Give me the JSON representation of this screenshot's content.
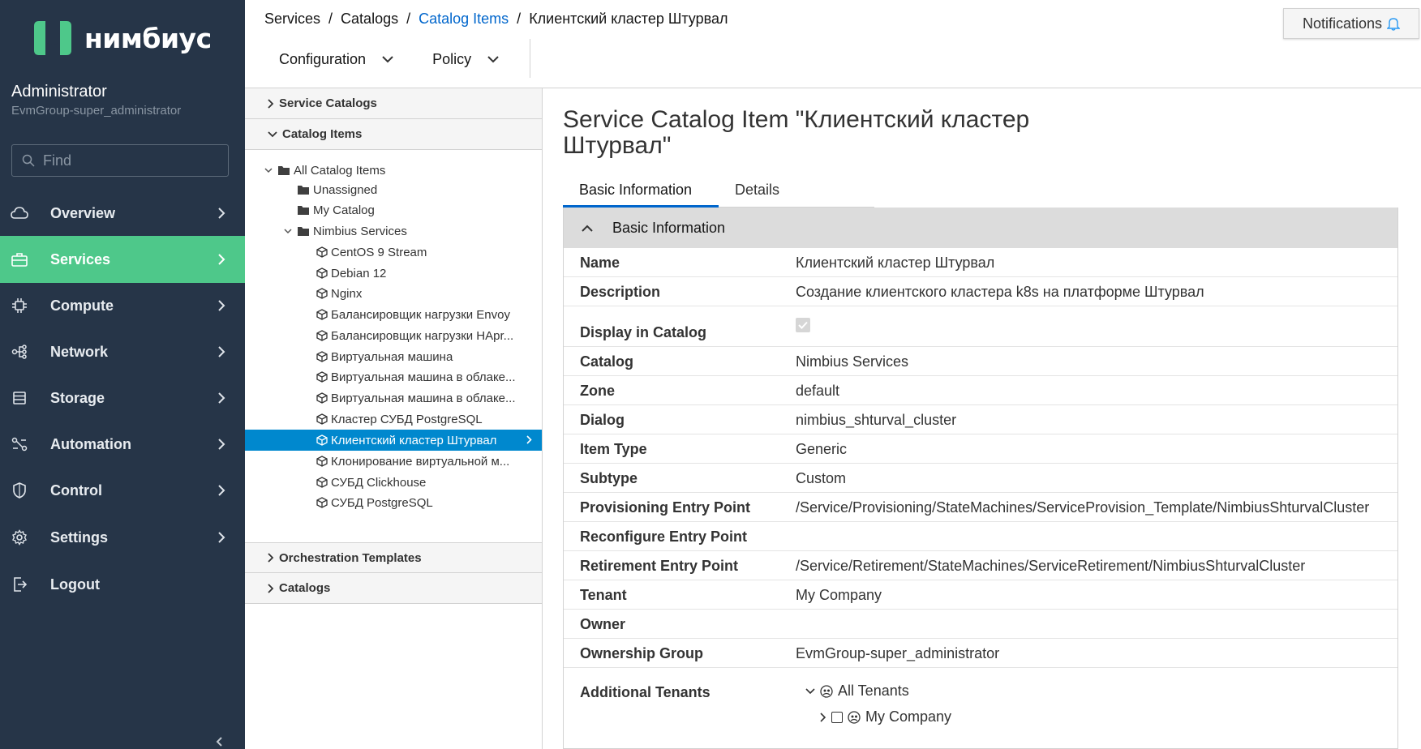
{
  "brand": {
    "name": "нимбиус",
    "color": "#4ec88a"
  },
  "user": {
    "name": "Administrator",
    "group": "EvmGroup-super_administrator"
  },
  "search": {
    "placeholder": "Find"
  },
  "nav": [
    {
      "label": "Overview",
      "icon": "cloud-icon",
      "active": false
    },
    {
      "label": "Services",
      "icon": "briefcase-icon",
      "active": true
    },
    {
      "label": "Compute",
      "icon": "chip-icon",
      "active": false
    },
    {
      "label": "Network",
      "icon": "network-icon",
      "active": false
    },
    {
      "label": "Storage",
      "icon": "storage-icon",
      "active": false
    },
    {
      "label": "Automation",
      "icon": "automation-icon",
      "active": false
    },
    {
      "label": "Control",
      "icon": "shield-icon",
      "active": false
    },
    {
      "label": "Settings",
      "icon": "gear-icon",
      "active": false
    },
    {
      "label": "Logout",
      "icon": "logout-icon",
      "active": false
    }
  ],
  "breadcrumb": [
    "Services",
    "Catalogs",
    "Catalog Items",
    "Клиентский кластер Штурвал"
  ],
  "toolbar": {
    "configuration": "Configuration",
    "policy": "Policy"
  },
  "notifications": "Notifications",
  "accordion": {
    "service_catalogs": "Service Catalogs",
    "catalog_items": "Catalog Items",
    "orchestration_templates": "Orchestration Templates",
    "catalogs": "Catalogs"
  },
  "tree": [
    {
      "label": "All Catalog Items",
      "type": "folder",
      "level": 0,
      "expanded": true
    },
    {
      "label": "Unassigned",
      "type": "folder",
      "level": 1
    },
    {
      "label": "My Catalog",
      "type": "folder",
      "level": 1
    },
    {
      "label": "Nimbius Services",
      "type": "folder",
      "level": 1,
      "expanded": true
    },
    {
      "label": "CentOS 9 Stream",
      "type": "item",
      "level": 2
    },
    {
      "label": "Debian 12",
      "type": "item",
      "level": 2
    },
    {
      "label": "Nginx",
      "type": "item",
      "level": 2
    },
    {
      "label": "Балансировщик нагрузки Envoy",
      "type": "item",
      "level": 2
    },
    {
      "label": "Балансировщик нагрузки HApr...",
      "type": "item",
      "level": 2
    },
    {
      "label": "Виртуальная машина",
      "type": "item",
      "level": 2
    },
    {
      "label": "Виртуальная машина в облаке...",
      "type": "item",
      "level": 2
    },
    {
      "label": "Виртуальная машина в облаке...",
      "type": "item",
      "level": 2
    },
    {
      "label": "Кластер СУБД PostgreSQL",
      "type": "item",
      "level": 2
    },
    {
      "label": "Клиентский кластер Штурвал",
      "type": "item",
      "level": 2,
      "selected": true
    },
    {
      "label": "Клонирование виртуальной м...",
      "type": "item",
      "level": 2
    },
    {
      "label": "СУБД Clickhouse",
      "type": "item",
      "level": 2
    },
    {
      "label": "СУБД PostgreSQL",
      "type": "item",
      "level": 2
    }
  ],
  "page_title": "Service Catalog Item \"Клиентский кластер Штурвал\"",
  "tabs": [
    "Basic Information",
    "Details"
  ],
  "panel_title": "Basic Information",
  "fields": [
    {
      "label": "Name",
      "value": "Клиентский кластер Штурвал"
    },
    {
      "label": "Description",
      "value": "Создание клиентского кластера k8s на платформе Штурвал"
    },
    {
      "label": "Display in Catalog",
      "value": "",
      "checkbox": true
    },
    {
      "label": "Catalog",
      "value": "Nimbius Services"
    },
    {
      "label": "Zone",
      "value": "default"
    },
    {
      "label": "Dialog",
      "value": "nimbius_shturval_cluster"
    },
    {
      "label": "Item Type",
      "value": "Generic"
    },
    {
      "label": "Subtype",
      "value": "Custom"
    },
    {
      "label": "Provisioning Entry Point",
      "value": "/Service/Provisioning/StateMachines/ServiceProvision_Template/NimbiusShturvalCluster"
    },
    {
      "label": "Reconfigure Entry Point",
      "value": ""
    },
    {
      "label": "Retirement Entry Point",
      "value": "/Service/Retirement/StateMachines/ServiceRetirement/NimbiusShturvalCluster"
    },
    {
      "label": "Tenant",
      "value": "My Company"
    },
    {
      "label": "Owner",
      "value": ""
    },
    {
      "label": "Ownership Group",
      "value": "EvmGroup-super_administrator"
    }
  ],
  "additional_tenants": {
    "label": "Additional Tenants",
    "root": "All Tenants",
    "child": "My Company"
  }
}
